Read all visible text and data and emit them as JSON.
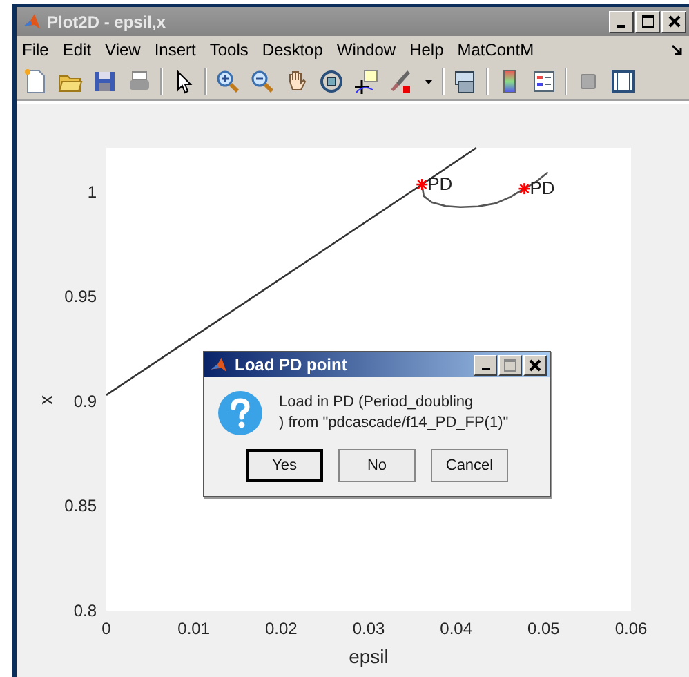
{
  "window": {
    "title": "Plot2D - epsil,x"
  },
  "menu": [
    "File",
    "Edit",
    "View",
    "Insert",
    "Tools",
    "Desktop",
    "Window",
    "Help",
    "MatContM"
  ],
  "plot": {
    "chart_data": {
      "type": "line",
      "xlabel": "epsil",
      "ylabel": "x",
      "xlim": [
        0,
        0.06
      ],
      "ylim": [
        0.8,
        1.021
      ],
      "xticks": [
        0,
        {
          "value": 0.01,
          "label": "0.01"
        },
        {
          "value": 0.02,
          "label": "0.02"
        },
        {
          "value": 0.03,
          "label": "0.03"
        },
        {
          "value": 0.04,
          "label": "0.04"
        },
        {
          "value": 0.05,
          "label": "0.05"
        },
        {
          "value": 0.06,
          "label": "0.06"
        }
      ],
      "yticks": [
        {
          "value": 0.8,
          "label": "0.8"
        },
        {
          "value": 0.85,
          "label": "0.85"
        },
        {
          "value": 0.9,
          "label": "0.9"
        },
        {
          "value": 0.95,
          "label": "0.95"
        },
        1
      ],
      "series": [
        {
          "color": "#333333",
          "x": [
            0,
            0.0361,
            0.0423
          ],
          "values": [
            0.903,
            1.0035,
            1.021
          ]
        },
        {
          "color": "#555555",
          "x": [
            0.0361,
            0.0363,
            0.0372,
            0.0388,
            0.0405,
            0.0425,
            0.0445,
            0.0462,
            0.0478,
            0.0492,
            0.0505
          ],
          "values": [
            1.0035,
            0.998,
            0.995,
            0.9932,
            0.9927,
            0.993,
            0.9945,
            0.9975,
            1.0015,
            1.005,
            1.0093
          ]
        }
      ],
      "annotations": [
        {
          "x": 0.0361,
          "y": 1.0035,
          "text": "PD"
        },
        {
          "x": 0.0478,
          "y": 1.0015,
          "text": "PD"
        }
      ]
    }
  },
  "dialog": {
    "title": "Load PD point",
    "message_lines": [
      "Load in PD (Period_doubling",
      ") from \"pdcascade/f14_PD_FP(1)\""
    ],
    "buttons": [
      {
        "label": "Yes",
        "default": true
      },
      {
        "label": "No",
        "default": false
      },
      {
        "label": "Cancel",
        "default": false
      }
    ]
  }
}
